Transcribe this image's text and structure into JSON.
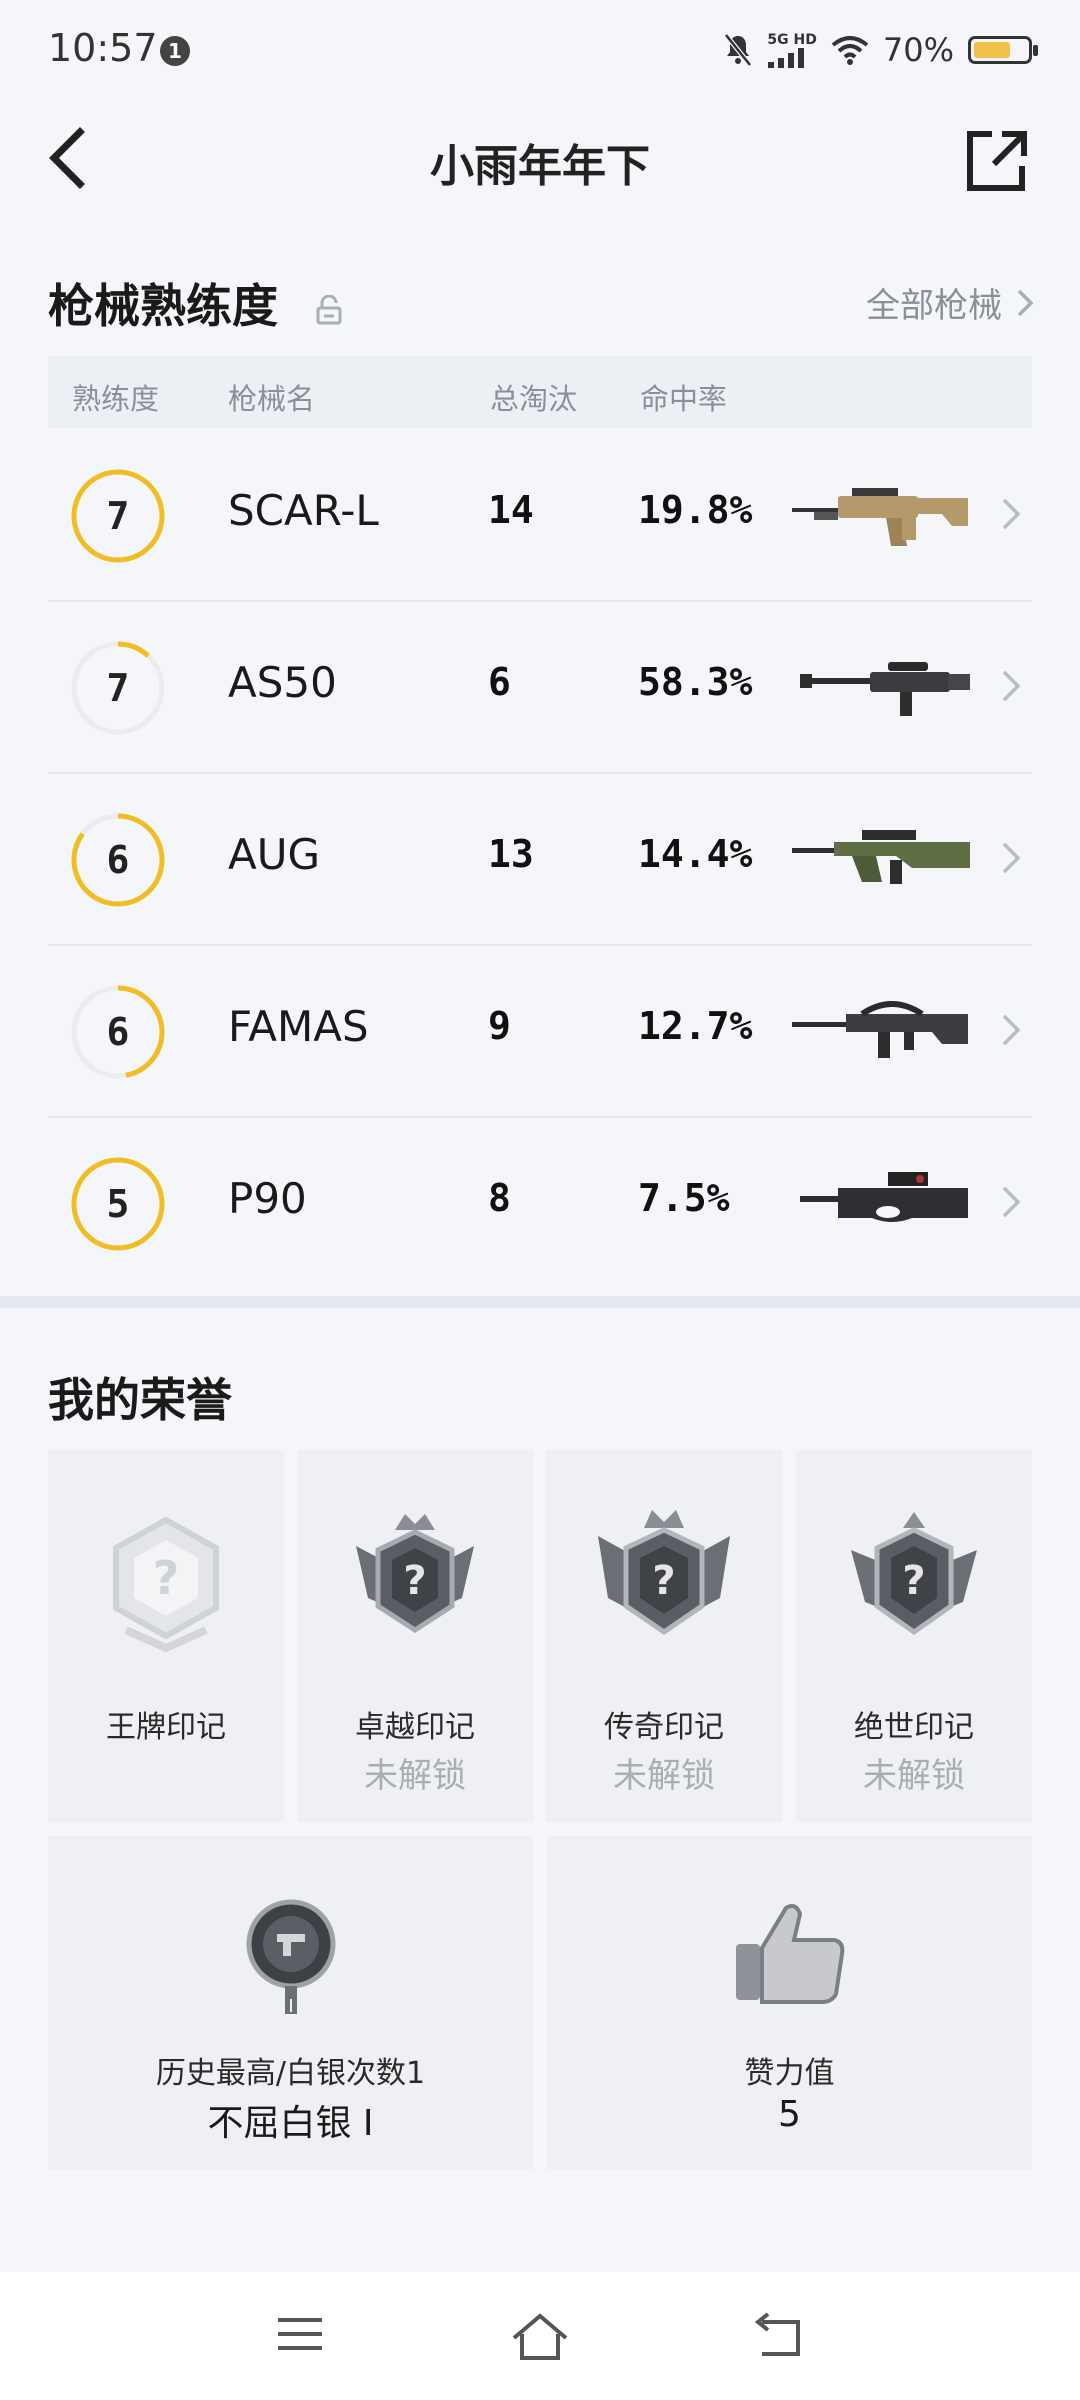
{
  "status_bar": {
    "time": "10:57",
    "notification_count": "1",
    "network": "5G HD",
    "battery_percent": "70%",
    "battery_level": 0.7,
    "battery_color": "#f0c24a"
  },
  "header": {
    "title": "小雨年年下",
    "back_icon": "back-arrow-icon",
    "share_icon": "share-external-icon"
  },
  "weapons_section": {
    "title": "枪械熟练度",
    "all_link": "全部枪械",
    "columns": [
      "熟练度",
      "枪械名",
      "总淘汰",
      "命中率"
    ],
    "rows": [
      {
        "level": "7",
        "name": "SCAR-L",
        "kills": "14",
        "hit_rate": "19.8%",
        "progress": 1.0
      },
      {
        "level": "7",
        "name": "AS50",
        "kills": "6",
        "hit_rate": "58.3%",
        "progress": 0.12
      },
      {
        "level": "6",
        "name": "AUG",
        "kills": "13",
        "hit_rate": "14.4%",
        "progress": 0.85
      },
      {
        "level": "6",
        "name": "FAMAS",
        "kills": "9",
        "hit_rate": "12.7%",
        "progress": 0.47
      },
      {
        "level": "5",
        "name": "P90",
        "kills": "8",
        "hit_rate": "7.5%",
        "progress": 1.0
      }
    ],
    "ring_color": "#f2bd22"
  },
  "honor_section": {
    "title": "我的荣誉",
    "marks": [
      {
        "name": "王牌印记",
        "status": ""
      },
      {
        "name": "卓越印记",
        "status": "未解锁"
      },
      {
        "name": "传奇印记",
        "status": "未解锁"
      },
      {
        "name": "绝世印记",
        "status": "未解锁"
      }
    ],
    "rank": {
      "label": "历史最高/白银次数1",
      "value": "不屈白银 Ⅰ"
    },
    "likes": {
      "label": "赞力值",
      "value": "5"
    }
  },
  "nav_bar": {
    "icons": [
      "menu-icon",
      "home-icon",
      "back-icon"
    ]
  }
}
